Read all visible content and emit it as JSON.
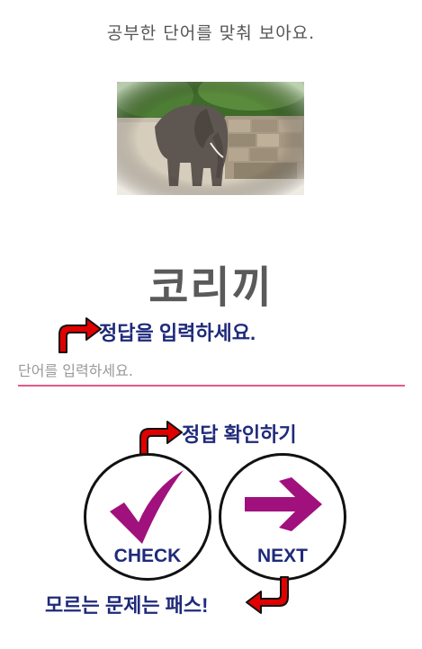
{
  "instruction": "공부한 단어를 맞춰 보아요.",
  "word": "코리끼",
  "answer_input": {
    "placeholder": "단어를 입력하세요.",
    "value": ""
  },
  "annotations": {
    "enter_answer": "정답을 입력하세요.",
    "check_answer": "정답 확인하기",
    "skip": "모르는 문제는 패스!"
  },
  "buttons": {
    "check_label": "CHECK",
    "next_label": "NEXT"
  },
  "icons": {
    "check": "checkmark-icon",
    "next": "arrow-right-icon",
    "pointer": "curved-arrow-icon"
  },
  "colors": {
    "accent": "#a0117e",
    "underline": "#e35a8a",
    "annotation_text": "#1f2a7a",
    "pointer_arrow": "#e00000"
  }
}
